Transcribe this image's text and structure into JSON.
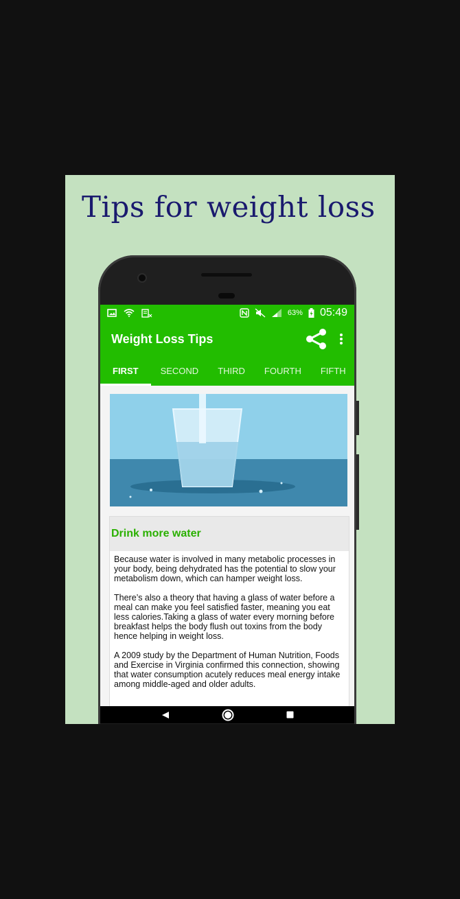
{
  "promo": {
    "heading": "Tips for weight loss"
  },
  "statusbar": {
    "battery_percent": "63%",
    "time": "05:49"
  },
  "appbar": {
    "title": "Weight Loss Tips"
  },
  "tabs": [
    {
      "label": "FIRST",
      "active": true
    },
    {
      "label": "SECOND"
    },
    {
      "label": "THIRD"
    },
    {
      "label": "FOURTH"
    },
    {
      "label": "FIFTH"
    }
  ],
  "tip": {
    "title": "Drink more water",
    "paragraphs": [
      "Because water is involved in many metabolic processes in your body, being dehydrated has the potential to slow your metabolism down, which can hamper weight loss.",
      "There’s also a theory that having a glass of water before a meal can make you feel satisfied faster, meaning you eat less calories.Taking a glass of water every morning before breakfast helps the body flush out toxins from the body hence helping in weight loss.",
      "A 2009 study by the Department of Human Nutrition, Foods and Exercise in Virginia confirmed this connection, showing that water consumption acutely reduces meal energy intake among middle-aged and older adults."
    ]
  },
  "colors": {
    "accent": "#22bd00",
    "title_green": "#2ab000",
    "promo_bg": "#c4e1c0",
    "heading": "#1a1a6e"
  },
  "icons": [
    "image-icon",
    "wifi-icon",
    "document-icon",
    "nfc-icon",
    "mute-icon",
    "signal-icon",
    "battery-icon",
    "share-icon",
    "more-vert-icon",
    "back-icon",
    "home-icon",
    "recents-icon"
  ]
}
